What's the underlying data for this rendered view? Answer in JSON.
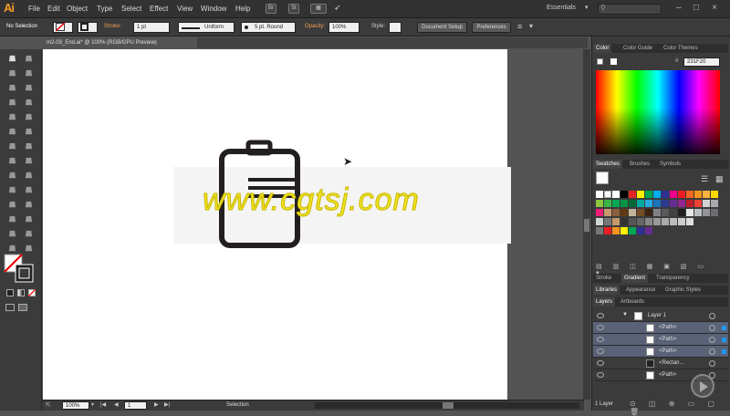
{
  "menubar": {
    "logo": "Ai",
    "items": [
      "File",
      "Edit",
      "Object",
      "Type",
      "Select",
      "Effect",
      "View",
      "Window",
      "Help"
    ],
    "bridge_label": "Br",
    "stock_label": "St",
    "workspace": "Essentials"
  },
  "control": {
    "selection": "No Selection",
    "stroke_label": "Stroke:",
    "stroke_value": "1 pt",
    "profile": "Uniform",
    "brush": "5 pt. Round",
    "opacity_label": "Opacity:",
    "opacity_value": "100%",
    "style_label": "Style:",
    "doc_setup": "Document Setup",
    "preferences": "Preferences"
  },
  "document": {
    "tab": "m2-03_End.ai* @ 100% (RGB/GPU Preview)",
    "watermark": "www.cgtsj.com"
  },
  "status": {
    "zoom": "100%",
    "artboard": "1",
    "mode": "Selection"
  },
  "panels": {
    "color_tabs": [
      "Color",
      "Color Guide",
      "Color Themes"
    ],
    "hex": "231F20",
    "swatch_tabs": [
      "Swatches",
      "Brushes",
      "Symbols"
    ],
    "stroke_tabs": [
      "Stroke",
      "Gradient",
      "Transparency"
    ],
    "lib_tabs": [
      "Libraries",
      "Appearance",
      "Graphic Styles"
    ],
    "layer_tabs": [
      "Layers",
      "Artboards"
    ],
    "layers": [
      {
        "name": "Layer 1",
        "selected": false
      },
      {
        "name": "<Path>",
        "selected": true
      },
      {
        "name": "<Path>",
        "selected": true
      },
      {
        "name": "<Path>",
        "selected": true
      },
      {
        "name": "<Rectan...",
        "selected": false
      },
      {
        "name": "<Path>",
        "selected": false
      }
    ],
    "layer_count": "1 Layer"
  },
  "colors": {
    "accent": "#f39a24",
    "icon_stroke": "#231f20",
    "selection": "#5a6278",
    "watermark": "#f0e323"
  }
}
